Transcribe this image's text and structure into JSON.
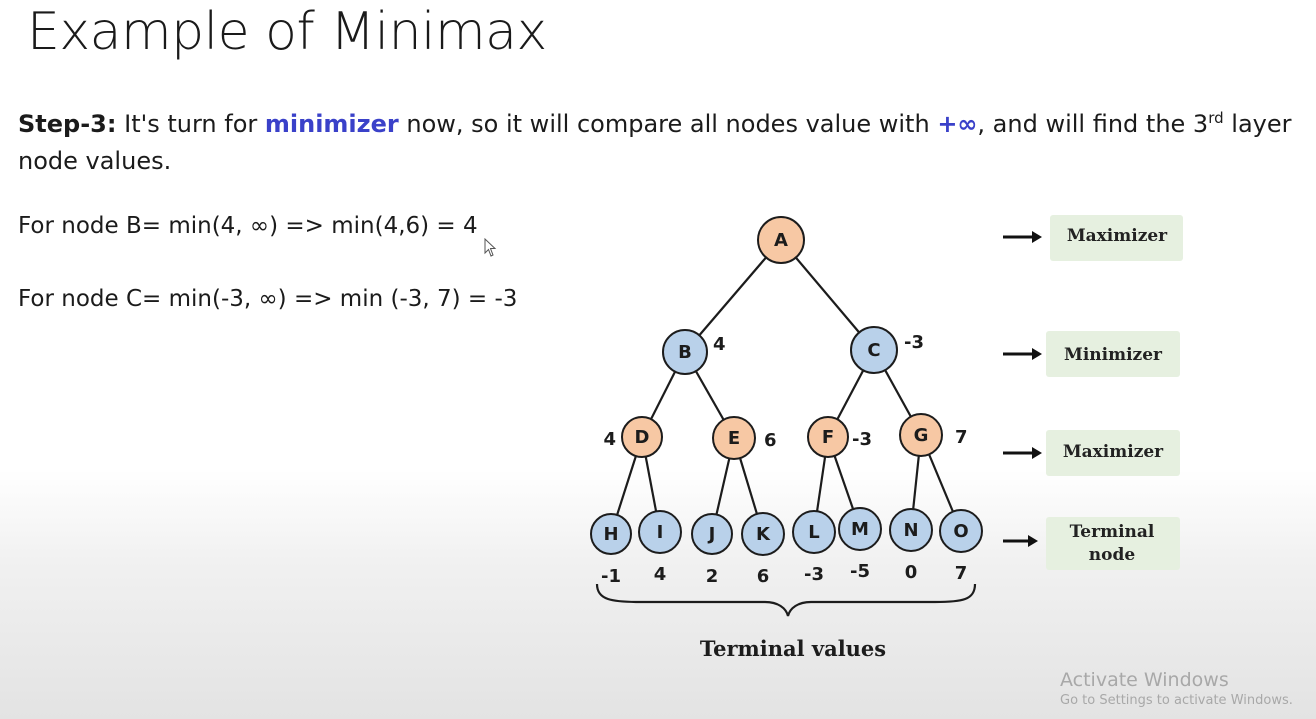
{
  "title": "Example of Minimax",
  "step": {
    "label": "Step-3:",
    "text_1": " It's turn for ",
    "minimizer": "minimizer",
    "text_2": " now, so it will compare all nodes value with ",
    "plus_inf": "+∞",
    "text_3": ", and will find the 3",
    "sup": "rd",
    "text_4": " layer node values."
  },
  "line_b": "For node B= min(4, ∞) => min(4,6) = 4",
  "line_c": "For node C= min(-3, ∞) => min (-3, 7) = -3",
  "tree": {
    "nodes": {
      "A": {
        "letter": "A",
        "value": "",
        "type": "max"
      },
      "B": {
        "letter": "B",
        "value": "4",
        "type": "min"
      },
      "C": {
        "letter": "C",
        "value": "-3",
        "type": "min"
      },
      "D": {
        "letter": "D",
        "value": "4",
        "type": "max"
      },
      "E": {
        "letter": "E",
        "value": "6",
        "type": "max"
      },
      "F": {
        "letter": "F",
        "value": "-3",
        "type": "max"
      },
      "G": {
        "letter": "G",
        "value": "7",
        "type": "max"
      },
      "H": {
        "letter": "H",
        "value": "-1",
        "type": "leaf"
      },
      "I": {
        "letter": "I",
        "value": "4",
        "type": "leaf"
      },
      "J": {
        "letter": "J",
        "value": "2",
        "type": "leaf"
      },
      "K": {
        "letter": "K",
        "value": "6",
        "type": "leaf"
      },
      "L": {
        "letter": "L",
        "value": "-3",
        "type": "leaf"
      },
      "M": {
        "letter": "M",
        "value": "-5",
        "type": "leaf"
      },
      "N": {
        "letter": "N",
        "value": "0",
        "type": "leaf"
      },
      "O": {
        "letter": "O",
        "value": "7",
        "type": "leaf"
      }
    },
    "edges": [
      [
        "A",
        "B"
      ],
      [
        "A",
        "C"
      ],
      [
        "B",
        "D"
      ],
      [
        "B",
        "E"
      ],
      [
        "C",
        "F"
      ],
      [
        "C",
        "G"
      ],
      [
        "D",
        "H"
      ],
      [
        "D",
        "I"
      ],
      [
        "E",
        "J"
      ],
      [
        "E",
        "K"
      ],
      [
        "F",
        "L"
      ],
      [
        "F",
        "M"
      ],
      [
        "G",
        "N"
      ],
      [
        "G",
        "O"
      ]
    ],
    "terminal_caption": "Terminal values",
    "colors": {
      "max_fill": "#f7c8a4",
      "min_fill": "#b9d1ea",
      "stroke": "#1c1c1c",
      "label_bg": "#e6f0e0"
    }
  },
  "level_labels": [
    "Maximizer",
    "Minimizer",
    "Maximizer",
    "Terminal node"
  ],
  "watermark": {
    "line1": "Activate Windows",
    "line2": "Go to Settings to activate Windows."
  }
}
